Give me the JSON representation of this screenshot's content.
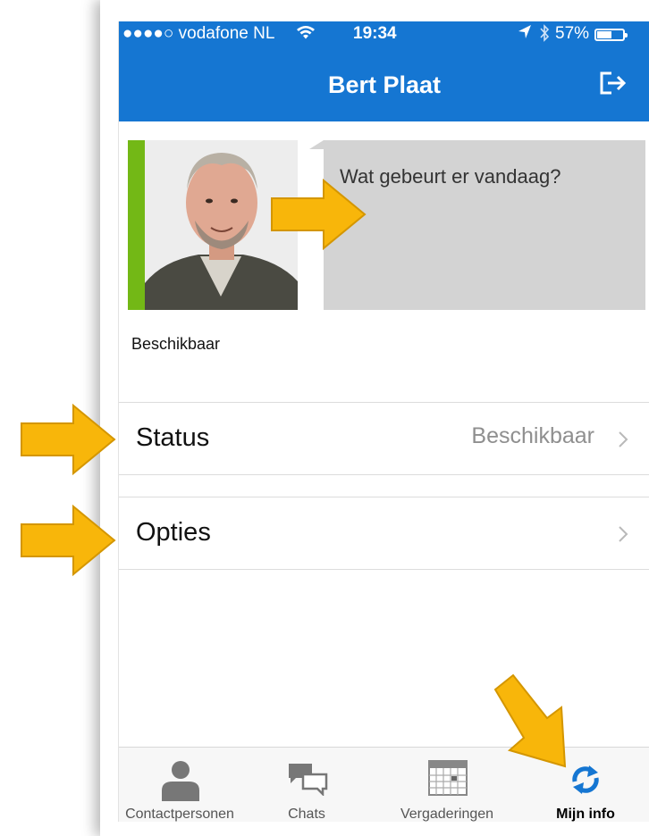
{
  "status_bar": {
    "carrier": "●●●●○ vodafone NL",
    "time": "19:34",
    "battery": "57%",
    "battery_level": 0.57
  },
  "header": {
    "title": "Bert Plaat",
    "signout_icon": "sign-out-icon"
  },
  "profile": {
    "status_prompt": "Wat gebeurt er vandaag?",
    "presence": "Beschikbaar",
    "presence_color": "#73b816"
  },
  "menu": {
    "status_label": "Status",
    "status_value": "Beschikbaar",
    "options_label": "Opties"
  },
  "tabs": [
    {
      "label": "Contactpersonen",
      "icon": "person-icon",
      "active": false
    },
    {
      "label": "Chats",
      "icon": "chat-bubbles-icon",
      "active": false
    },
    {
      "label": "Vergaderingen",
      "icon": "calendar-icon",
      "active": false
    },
    {
      "label": "Mijn info",
      "icon": "sync-arrows-icon",
      "active": true
    }
  ],
  "colors": {
    "header": "#1576d2",
    "annotation_arrow": "#f8b60a"
  }
}
